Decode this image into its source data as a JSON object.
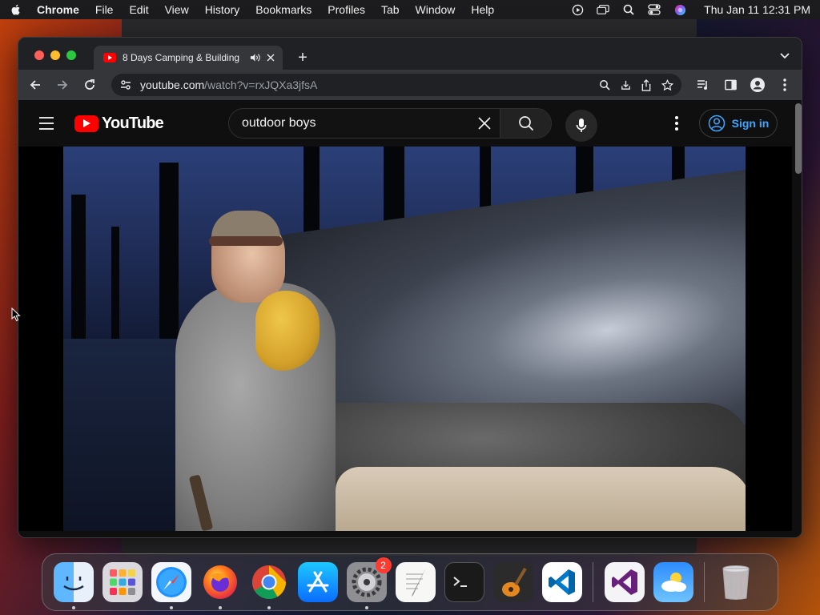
{
  "menubar": {
    "app_name": "Chrome",
    "items": [
      "File",
      "Edit",
      "View",
      "History",
      "Bookmarks",
      "Profiles",
      "Tab",
      "Window",
      "Help"
    ],
    "clock": "Thu Jan 11  12:31 PM"
  },
  "browser": {
    "tab": {
      "title": "8 Days Camping & Building"
    },
    "new_tab_label": "+",
    "url_host": "youtube.com",
    "url_path": "/watch?v=rxJQXa3jfsA"
  },
  "youtube": {
    "logo_text": "YouTube",
    "search_value": "outdoor boys",
    "sign_in_label": "Sign in",
    "accent": "#ff0000",
    "link_color": "#3ea6ff"
  },
  "dock": {
    "items": [
      {
        "name": "finder-icon",
        "running": true
      },
      {
        "name": "launchpad-icon",
        "running": false
      },
      {
        "name": "safari-icon",
        "running": true
      },
      {
        "name": "firefox-icon",
        "running": true
      },
      {
        "name": "chrome-icon",
        "running": true
      },
      {
        "name": "app-store-icon",
        "running": false
      },
      {
        "name": "system-settings-icon",
        "running": true,
        "badge": "2"
      },
      {
        "name": "textedit-icon",
        "running": false
      },
      {
        "name": "terminal-icon",
        "running": false
      },
      {
        "name": "garageband-icon",
        "running": false
      },
      {
        "name": "vscode-icon",
        "running": false
      },
      {
        "name": "visual-studio-icon",
        "running": false
      },
      {
        "name": "weather-icon",
        "running": false
      },
      {
        "name": "trash-icon",
        "running": false
      }
    ]
  }
}
